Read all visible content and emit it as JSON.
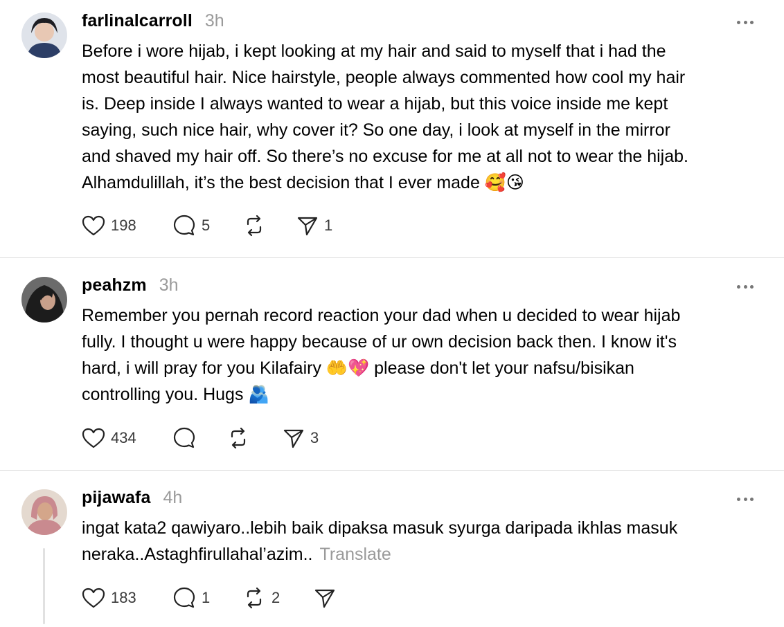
{
  "posts": [
    {
      "username": "farlinalcarroll",
      "time": "3h",
      "text": "Before i wore hijab, i kept looking at my hair and said to myself that i had the\nmost beautiful hair. Nice hairstyle, people always commented how cool my hair\nis. Deep inside I always wanted to wear a hijab, but this voice inside me kept\nsaying, such nice hair, why cover it? So one day, i look at myself in the mirror\nand shaved my hair off. So there’s no excuse for me at all not to wear the hijab.\nAlhamdulillah, it’s the best decision that I ever made 🥰😘",
      "likes": "198",
      "replies": "5",
      "reposts": "",
      "shares": "1",
      "avatar_color": "#2c3e66"
    },
    {
      "username": "peahzm",
      "time": "3h",
      "text": "Remember you pernah record reaction your dad when u decided to wear hijab\nfully. I thought u were happy because of ur own decision back then. I know it's\nhard, i will pray for you Kilafairy 🤲💖 please don't let your nafsu/bisikan\ncontrolling you. Hugs 🫂",
      "likes": "434",
      "replies": "",
      "reposts": "",
      "shares": "3",
      "avatar_color": "#3a3a3a"
    },
    {
      "username": "pijawafa",
      "time": "4h",
      "text": "ingat kata2 qawiyaro..lebih baik dipaksa masuk syurga daripada ikhlas masuk\nneraka..Astaghfirullahal’azim..",
      "translate": "Translate",
      "likes": "183",
      "replies": "1",
      "reposts": "2",
      "shares": "",
      "avatar_color": "#c98a8f"
    }
  ],
  "icons": {
    "like": "heart-icon",
    "reply": "comment-icon",
    "repost": "repost-icon",
    "share": "send-icon",
    "more": "more-options-icon"
  },
  "colors": {
    "text": "#000000",
    "muted": "#9a9a9a",
    "divider": "#dcdcdc"
  }
}
